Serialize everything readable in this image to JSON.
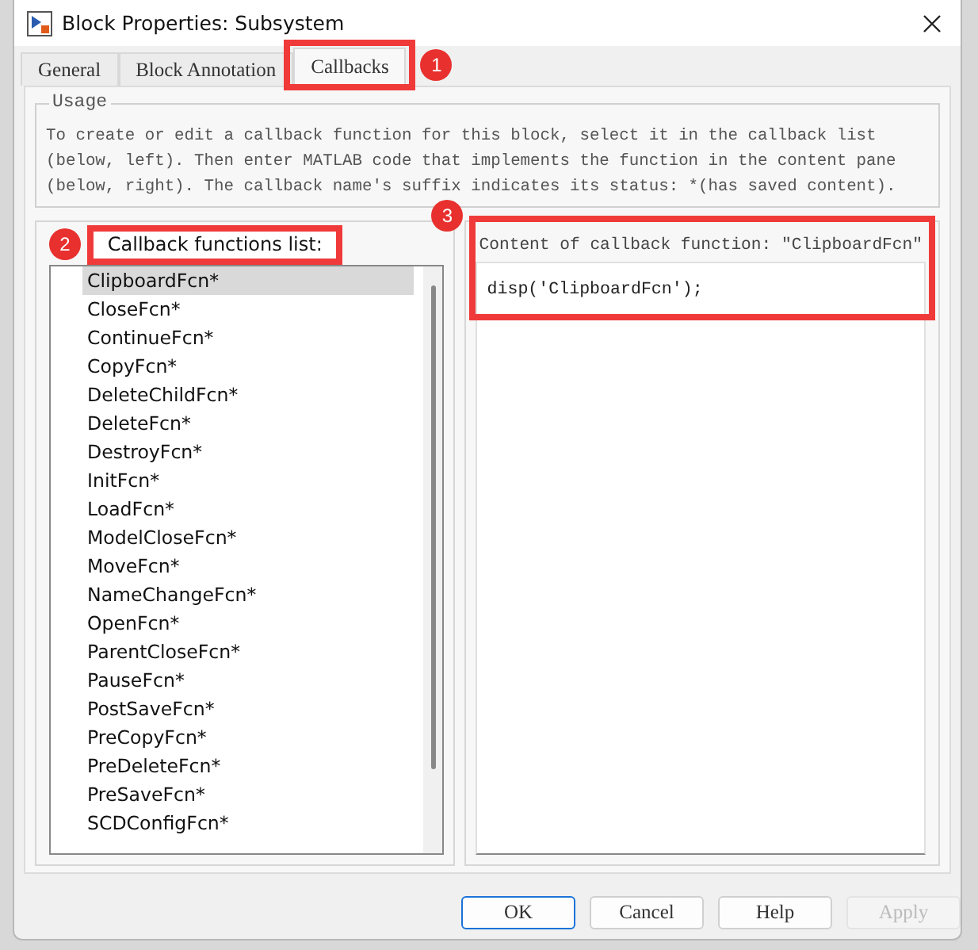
{
  "window": {
    "title": "Block Properties: Subsystem"
  },
  "tabs": [
    {
      "label": "General",
      "selected": false
    },
    {
      "label": "Block Annotation",
      "selected": false
    },
    {
      "label": "Callbacks",
      "selected": true
    }
  ],
  "usage": {
    "title": "Usage",
    "text": "To create or edit a callback function for this block, select it in the callback list\n(below, left). Then enter MATLAB code that implements the function in the content pane\n(below, right). The callback name's suffix indicates its status: *(has saved content)."
  },
  "callback_list": {
    "label": "Callback functions list:",
    "items": [
      {
        "label": "ClipboardFcn*",
        "selected": true
      },
      {
        "label": "CloseFcn*",
        "selected": false
      },
      {
        "label": "ContinueFcn*",
        "selected": false
      },
      {
        "label": "CopyFcn*",
        "selected": false
      },
      {
        "label": "DeleteChildFcn*",
        "selected": false
      },
      {
        "label": "DeleteFcn*",
        "selected": false
      },
      {
        "label": "DestroyFcn*",
        "selected": false
      },
      {
        "label": "InitFcn*",
        "selected": false
      },
      {
        "label": "LoadFcn*",
        "selected": false
      },
      {
        "label": "ModelCloseFcn*",
        "selected": false
      },
      {
        "label": "MoveFcn*",
        "selected": false
      },
      {
        "label": "NameChangeFcn*",
        "selected": false
      },
      {
        "label": "OpenFcn*",
        "selected": false
      },
      {
        "label": "ParentCloseFcn*",
        "selected": false
      },
      {
        "label": "PauseFcn*",
        "selected": false
      },
      {
        "label": "PostSaveFcn*",
        "selected": false
      },
      {
        "label": "PreCopyFcn*",
        "selected": false
      },
      {
        "label": "PreDeleteFcn*",
        "selected": false
      },
      {
        "label": "PreSaveFcn*",
        "selected": false
      },
      {
        "label": "SCDConfigFcn*",
        "selected": false
      }
    ]
  },
  "content": {
    "label": "Content of callback function: \"ClipboardFcn\"",
    "code": "disp('ClipboardFcn');"
  },
  "callouts": [
    "1",
    "2",
    "3"
  ],
  "buttons": [
    {
      "label": "OK",
      "focused": true,
      "disabled": false
    },
    {
      "label": "Cancel",
      "focused": false,
      "disabled": false
    },
    {
      "label": "Help",
      "focused": false,
      "disabled": false
    },
    {
      "label": "Apply",
      "focused": false,
      "disabled": true
    }
  ]
}
